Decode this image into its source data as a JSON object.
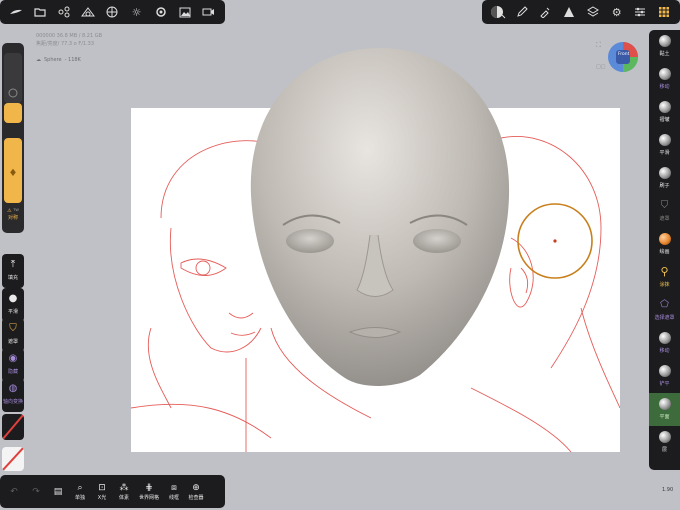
{
  "top_left_toolbar": {
    "icons": [
      "brush-icon",
      "folder-icon",
      "scene-share-icon",
      "shapes-icon",
      "layers-sphere-icon",
      "light-icon",
      "settings-icon",
      "image-icon",
      "video-icon"
    ]
  },
  "top_right_toolbar": {
    "icons": [
      "material-icon",
      "pen-icon",
      "dropper-icon",
      "triangle-icon",
      "stack-icon",
      "gear-icon",
      "sliders-icon",
      "grid-tool-icon"
    ]
  },
  "info": {
    "line1": "000000   36.8 MB / 8.21 GB",
    "line2": "焦距/亮度/   77.3 o   F/1.33"
  },
  "mesh": {
    "name": "Sphere",
    "count": "- 118K"
  },
  "left_panel": {
    "symmetry_label": "对称",
    "symmetry_badge": "TW",
    "fill_label": "填充",
    "smooth_label": "平滑",
    "mask_label": "遮罩",
    "hide_label": "隐藏",
    "axis_label": "轴向变换"
  },
  "bottom_toolbar": {
    "items": [
      {
        "icon": "undo-icon",
        "label": ""
      },
      {
        "icon": "redo-icon",
        "label": ""
      },
      {
        "icon": "save-icon",
        "label": ""
      },
      {
        "icon": "search-icon",
        "label": "单独"
      },
      {
        "icon": "xray-icon",
        "label": "X光"
      },
      {
        "icon": "vertex-icon",
        "label": "体素"
      },
      {
        "icon": "grid-icon",
        "label": "世界网格"
      },
      {
        "icon": "wireframe-icon",
        "label": "线框"
      },
      {
        "icon": "inspector-icon",
        "label": "检查器"
      }
    ]
  },
  "right_tools": [
    {
      "label": "黏土",
      "ball": "#d0d0d0"
    },
    {
      "label": "移动",
      "ball": "#d0d0d0"
    },
    {
      "label": "褶皱",
      "ball": "#d0d0d0"
    },
    {
      "label": "平滑",
      "ball": "#d0d0d0"
    },
    {
      "label": "刷子",
      "ball": "#d0d0d0"
    },
    {
      "label": "遮罩",
      "ball": "#d0d0d0"
    },
    {
      "label": "绘画",
      "ball": "#e88830"
    },
    {
      "label": "涂抹",
      "ball": "#f0c050"
    },
    {
      "label": "选择遮罩",
      "ball": "#a58ad8"
    },
    {
      "label": "移动",
      "ball": "#d0d0d0"
    },
    {
      "label": "铲平",
      "ball": "#d0d0d0"
    },
    {
      "label": "平面",
      "ball": "#d0d0d0"
    },
    {
      "label": "层",
      "ball": "#d0d0d0"
    }
  ],
  "viewport": {
    "gizmo_label": "Front",
    "zoom": "1.90"
  },
  "colors": {
    "accent": "#f0b64a",
    "active_tool": "#3e6b3b",
    "sketch": "#e0403c"
  }
}
